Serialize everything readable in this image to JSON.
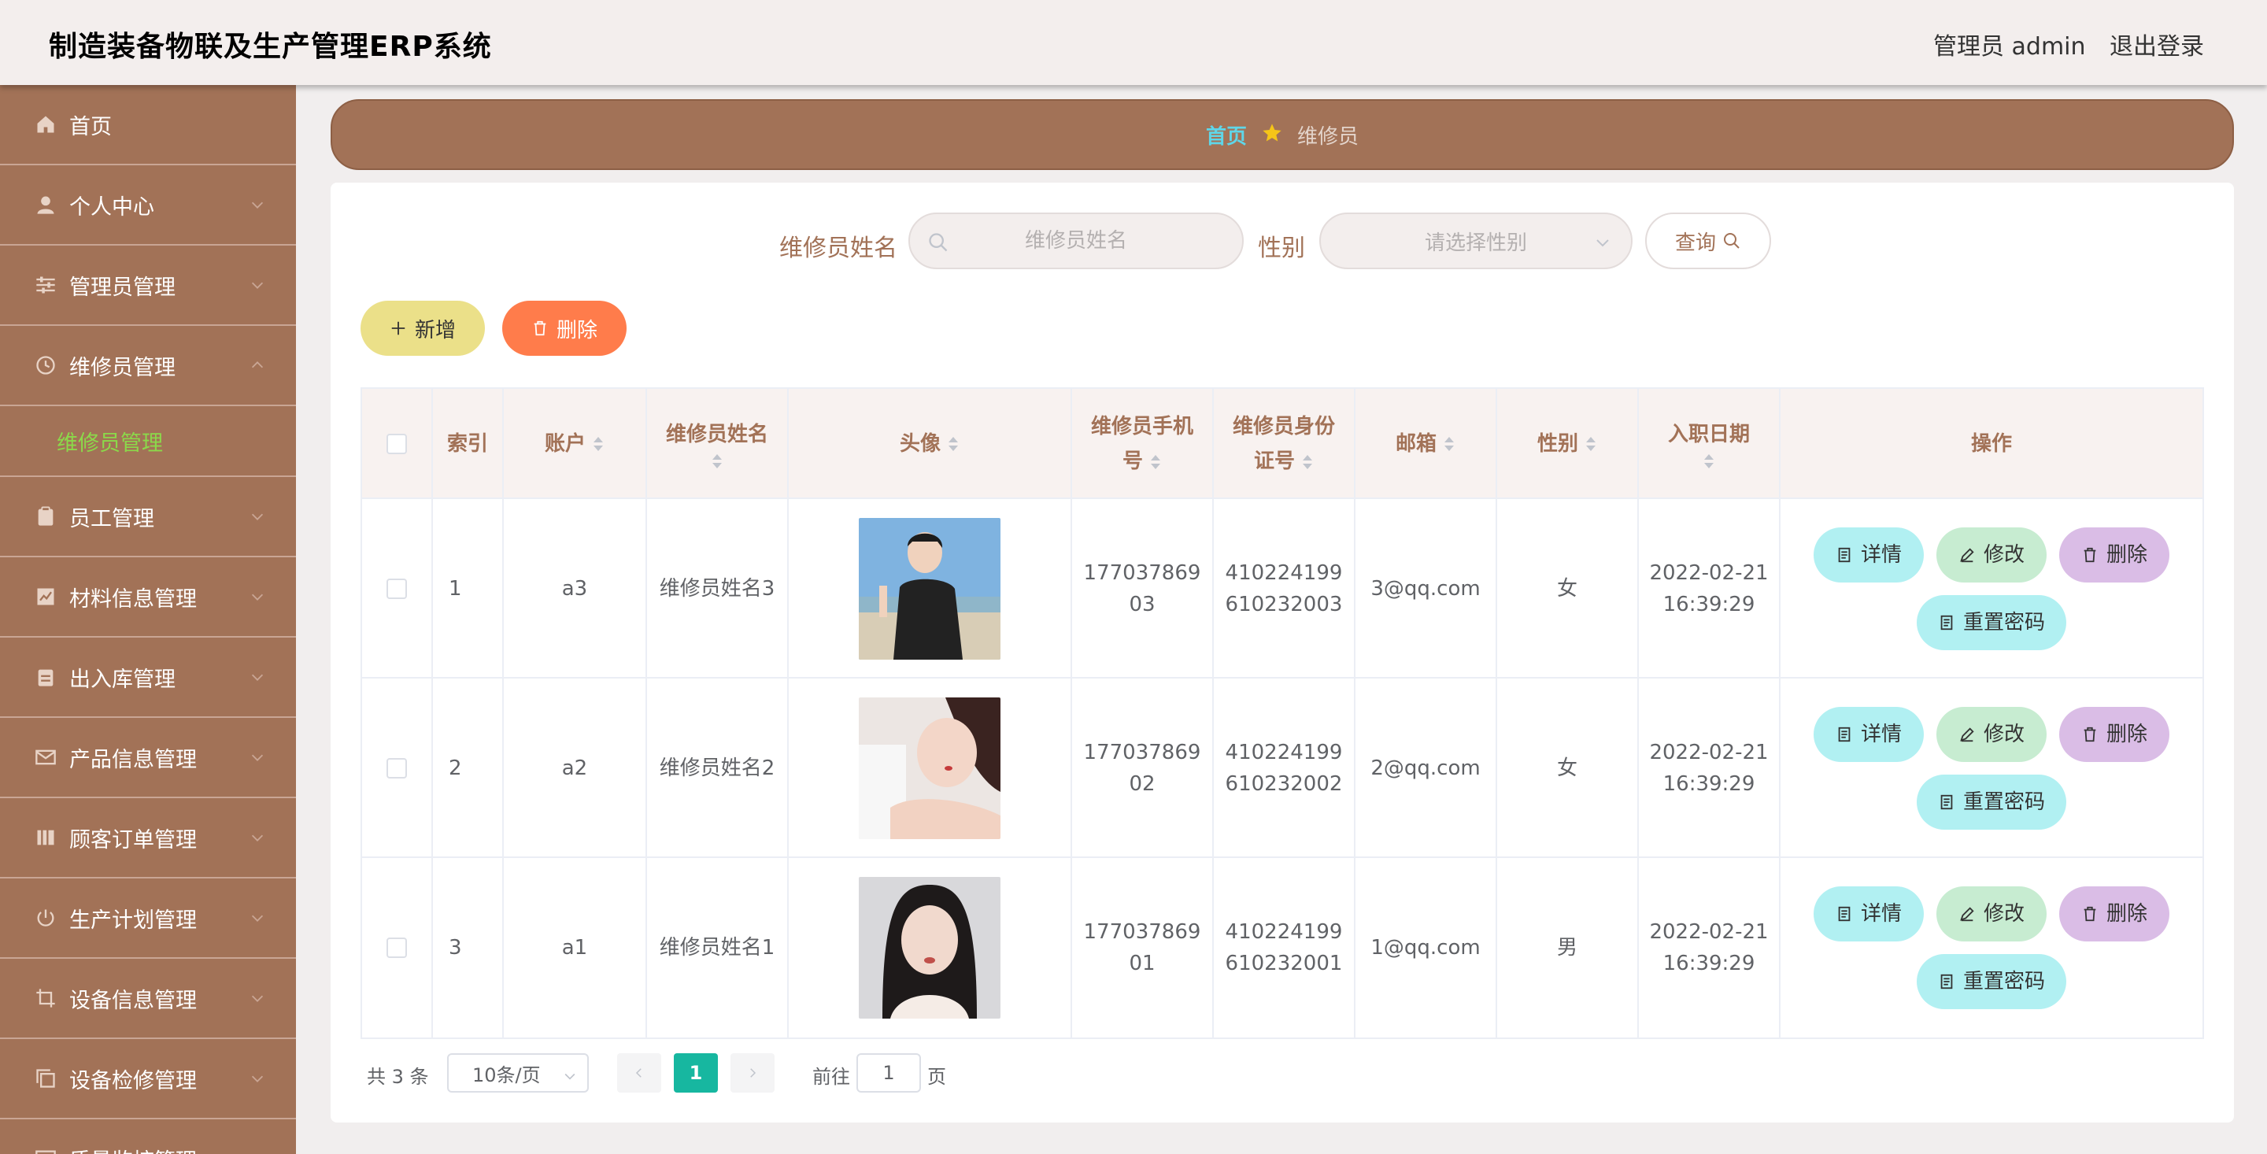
{
  "header": {
    "title": "制造装备物联及生产管理ERP系统",
    "user": "管理员 admin",
    "logout": "退出登录"
  },
  "sidebar": {
    "items": [
      {
        "label": "首页",
        "icon": "home-icon"
      },
      {
        "label": "个人中心",
        "icon": "user-icon"
      },
      {
        "label": "管理员管理",
        "icon": "sliders-icon"
      },
      {
        "label": "维修员管理",
        "icon": "clock-icon",
        "expanded": true
      },
      {
        "label": "维修员管理",
        "sub": true,
        "active": true
      },
      {
        "label": "员工管理",
        "icon": "clipboard-icon"
      },
      {
        "label": "材料信息管理",
        "icon": "chart-icon"
      },
      {
        "label": "出入库管理",
        "icon": "clipboard-list-icon"
      },
      {
        "label": "产品信息管理",
        "icon": "mail-icon"
      },
      {
        "label": "顾客订单管理",
        "icon": "bars-icon"
      },
      {
        "label": "生产计划管理",
        "icon": "power-icon"
      },
      {
        "label": "设备信息管理",
        "icon": "crop-icon"
      },
      {
        "label": "设备检修管理",
        "icon": "copy-icon"
      },
      {
        "label": "质量监控管理",
        "icon": "monitor-icon"
      }
    ]
  },
  "breadcrumb": {
    "home": "首页",
    "current": "维修员"
  },
  "search": {
    "name_label": "维修员姓名",
    "name_placeholder": "维修员姓名",
    "gender_label": "性别",
    "gender_placeholder": "请选择性别",
    "query_label": "查询"
  },
  "actions": {
    "add": "新增",
    "delete": "删除"
  },
  "table": {
    "headers": {
      "index": "索引",
      "account": "账户",
      "name": "维修员姓名",
      "avatar": "头像",
      "phone": "维修员手机号",
      "idcard": "维修员身份证号",
      "email": "邮箱",
      "gender": "性别",
      "hire_date": "入职日期",
      "ops": "操作"
    },
    "rows": [
      {
        "index": "1",
        "account": "a3",
        "name": "维修员姓名3",
        "phone_a": "177037869",
        "phone_b": "03",
        "id_a": "410224199",
        "id_b": "610232003",
        "email": "3@qq.com",
        "gender": "女",
        "date": "2022-02-21",
        "time": "16:39:29"
      },
      {
        "index": "2",
        "account": "a2",
        "name": "维修员姓名2",
        "phone_a": "177037869",
        "phone_b": "02",
        "id_a": "410224199",
        "id_b": "610232002",
        "email": "2@qq.com",
        "gender": "女",
        "date": "2022-02-21",
        "time": "16:39:29"
      },
      {
        "index": "3",
        "account": "a1",
        "name": "维修员姓名1",
        "phone_a": "177037869",
        "phone_b": "01",
        "id_a": "410224199",
        "id_b": "610232001",
        "email": "1@qq.com",
        "gender": "男",
        "date": "2022-02-21",
        "time": "16:39:29"
      }
    ],
    "op_labels": {
      "detail": "详情",
      "edit": "修改",
      "delete": "删除",
      "reset": "重置密码"
    }
  },
  "pagination": {
    "total": "共 3 条",
    "page_size": "10条/页",
    "current": "1",
    "goto": "前往",
    "page_input": "1",
    "page_unit": "页"
  },
  "colors": {
    "brand": "#a27257",
    "active_sub": "#8bd94a",
    "page_active": "#17b7a0",
    "add_btn": "#ebe089",
    "del_btn": "#ff7c4b"
  }
}
